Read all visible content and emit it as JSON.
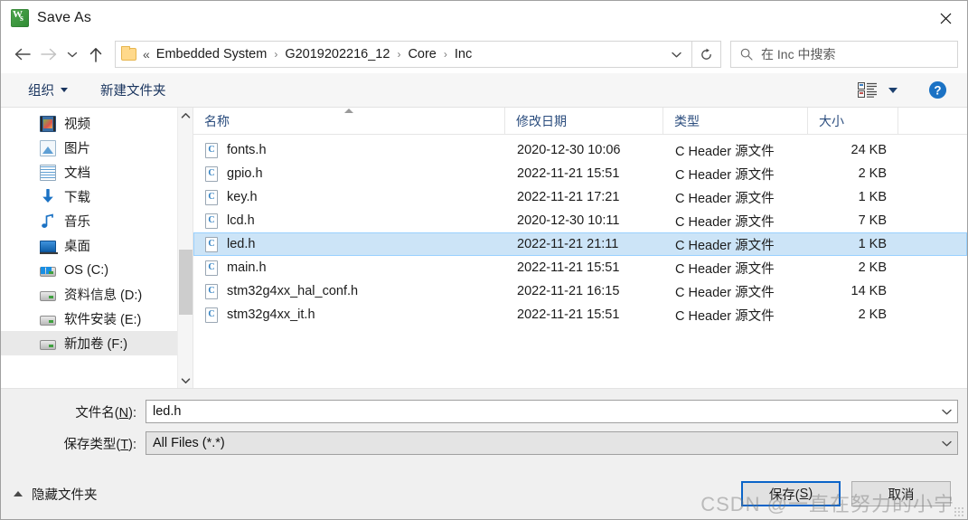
{
  "window": {
    "title": "Save As",
    "app_icon": "wps-app-icon",
    "close_icon": "close-icon"
  },
  "nav": {
    "back_icon": "back-arrow-icon",
    "forward_icon": "forward-arrow-icon",
    "history_icon": "chevron-down-icon",
    "up_icon": "up-arrow-icon",
    "refresh_icon": "refresh-icon",
    "address_chevron_icon": "chevron-down-icon",
    "folder_icon": "folder-icon",
    "breadcrumb_lead": "«",
    "breadcrumbs": [
      "Embedded System",
      "G2019202216_12",
      "Core",
      "Inc"
    ],
    "separator": "›"
  },
  "search": {
    "icon": "search-icon",
    "placeholder": "在 Inc 中搜索"
  },
  "commandbar": {
    "organize_label": "组织",
    "new_folder_label": "新建文件夹",
    "view_icon": "view-layout-icon",
    "view_caret_icon": "chevron-down-icon",
    "help_icon": "help-circle-icon"
  },
  "sidebar": {
    "items": [
      {
        "label": "视频",
        "icon": "video-icon",
        "selected": false
      },
      {
        "label": "图片",
        "icon": "picture-icon",
        "selected": false
      },
      {
        "label": "文档",
        "icon": "document-icon",
        "selected": false
      },
      {
        "label": "下载",
        "icon": "download-icon",
        "selected": false
      },
      {
        "label": "音乐",
        "icon": "music-icon",
        "selected": false
      },
      {
        "label": "桌面",
        "icon": "desktop-icon",
        "selected": false
      },
      {
        "label": "OS (C:)",
        "icon": "os-drive-icon",
        "selected": false
      },
      {
        "label": "资料信息 (D:)",
        "icon": "drive-icon",
        "selected": false
      },
      {
        "label": "软件安装 (E:)",
        "icon": "drive-icon",
        "selected": false
      },
      {
        "label": "新加卷 (F:)",
        "icon": "drive-icon",
        "selected": true
      }
    ],
    "scroll_up_icon": "chevron-up-icon",
    "scroll_down_icon": "chevron-down-icon"
  },
  "filelist": {
    "columns": [
      {
        "label": "名称",
        "sorted": true
      },
      {
        "label": "修改日期",
        "sorted": false
      },
      {
        "label": "类型",
        "sorted": false
      },
      {
        "label": "大小",
        "sorted": false
      }
    ],
    "sort_caret_icon": "sort-ascending-icon",
    "rows": [
      {
        "icon": "c-header-file-icon",
        "name": "fonts.h",
        "date": "2020-12-30 10:06",
        "type": "C Header 源文件",
        "size": "24 KB",
        "selected": false
      },
      {
        "icon": "c-header-file-icon",
        "name": "gpio.h",
        "date": "2022-11-21 15:51",
        "type": "C Header 源文件",
        "size": "2 KB",
        "selected": false
      },
      {
        "icon": "c-header-file-icon",
        "name": "key.h",
        "date": "2022-11-21 17:21",
        "type": "C Header 源文件",
        "size": "1 KB",
        "selected": false
      },
      {
        "icon": "c-header-file-icon",
        "name": "lcd.h",
        "date": "2020-12-30 10:11",
        "type": "C Header 源文件",
        "size": "7 KB",
        "selected": false
      },
      {
        "icon": "c-header-file-icon",
        "name": "led.h",
        "date": "2022-11-21 21:11",
        "type": "C Header 源文件",
        "size": "1 KB",
        "selected": true
      },
      {
        "icon": "c-header-file-icon",
        "name": "main.h",
        "date": "2022-11-21 15:51",
        "type": "C Header 源文件",
        "size": "2 KB",
        "selected": false
      },
      {
        "icon": "c-header-file-icon",
        "name": "stm32g4xx_hal_conf.h",
        "date": "2022-11-21 16:15",
        "type": "C Header 源文件",
        "size": "14 KB",
        "selected": false
      },
      {
        "icon": "c-header-file-icon",
        "name": "stm32g4xx_it.h",
        "date": "2022-11-21 15:51",
        "type": "C Header 源文件",
        "size": "2 KB",
        "selected": false
      }
    ],
    "file_icon_letter": "C"
  },
  "form": {
    "filename_label_pre": "文件名(",
    "filename_label_key": "N",
    "filename_label_post": "):",
    "filename_value": "led.h",
    "savetype_label_pre": "保存类型(",
    "savetype_label_key": "T",
    "savetype_label_post": "):",
    "savetype_value": "All Files (*.*)",
    "dropdown_icon": "chevron-down-icon"
  },
  "footer": {
    "hide_folders_label": "隐藏文件夹",
    "hide_folders_icon": "chevron-up-icon",
    "save_label_pre": "保存(",
    "save_label_key": "S",
    "save_label_post": ")",
    "cancel_label": "取消",
    "resize_grip_icon": "resize-grip-icon"
  },
  "watermark": {
    "text": "CSDN @一直在努力的小宁"
  },
  "colors": {
    "selection_bg": "#cce4f7",
    "selection_border": "#99d1ff",
    "focus_border": "#0a64c8",
    "header_text": "#2b4d7e",
    "command_text": "#19345e",
    "chrome_bg": "#f0f0f0"
  }
}
